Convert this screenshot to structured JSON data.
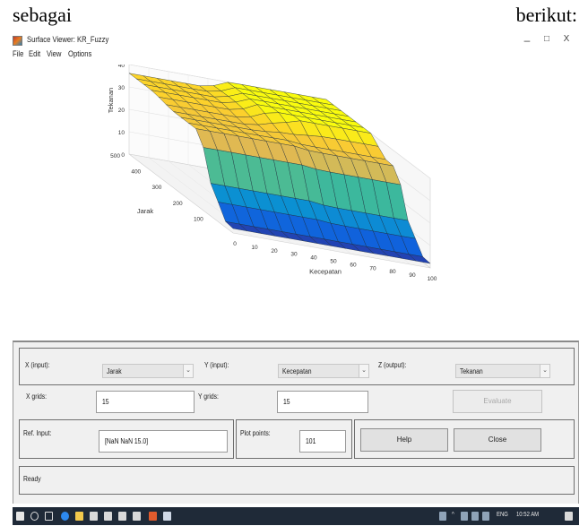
{
  "document": {
    "left_word": "sebagai",
    "right_word": "berikut:"
  },
  "window": {
    "title": "Surface Viewer: KR_Fuzzy",
    "minimize": "–",
    "maximize": "□",
    "close": "X"
  },
  "menu": {
    "items": [
      "File",
      "Edit",
      "View",
      "Options"
    ]
  },
  "chart_data": {
    "type": "surface",
    "zlabel": "Tekanan",
    "ylabel": "Jarak",
    "xlabel": "Kecepatan",
    "x_ticks": [
      "0",
      "10",
      "20",
      "30",
      "40",
      "50",
      "60",
      "70",
      "80",
      "90",
      "100"
    ],
    "y_ticks": [
      "100",
      "200",
      "300",
      "400",
      "500"
    ],
    "z_ticks": [
      "0",
      "10",
      "20",
      "30",
      "40"
    ],
    "x_range": [
      0,
      100
    ],
    "y_range": [
      0,
      500
    ],
    "z_range": [
      0,
      40
    ],
    "grid": "x15x15",
    "colormap": "parula"
  },
  "controls": {
    "x_input_label": "X (input):",
    "x_input_value": "Jarak",
    "y_input_label": "Y (input):",
    "y_input_value": "Kecepatan",
    "z_output_label": "Z (output):",
    "z_output_value": "Tekanan",
    "x_grids_label": "X grids:",
    "x_grids_value": "15",
    "y_grids_label": "Y grids:",
    "y_grids_value": "15",
    "evaluate_label": "Evaluate",
    "ref_input_label": "Ref. Input:",
    "ref_input_value": "[NaN NaN 15.0]",
    "plot_points_label": "Plot points:",
    "plot_points_value": "101",
    "help_label": "Help",
    "close_label": "Close",
    "status": "Ready"
  },
  "taskbar": {
    "language": "ENG",
    "time": "10:52 AM"
  }
}
